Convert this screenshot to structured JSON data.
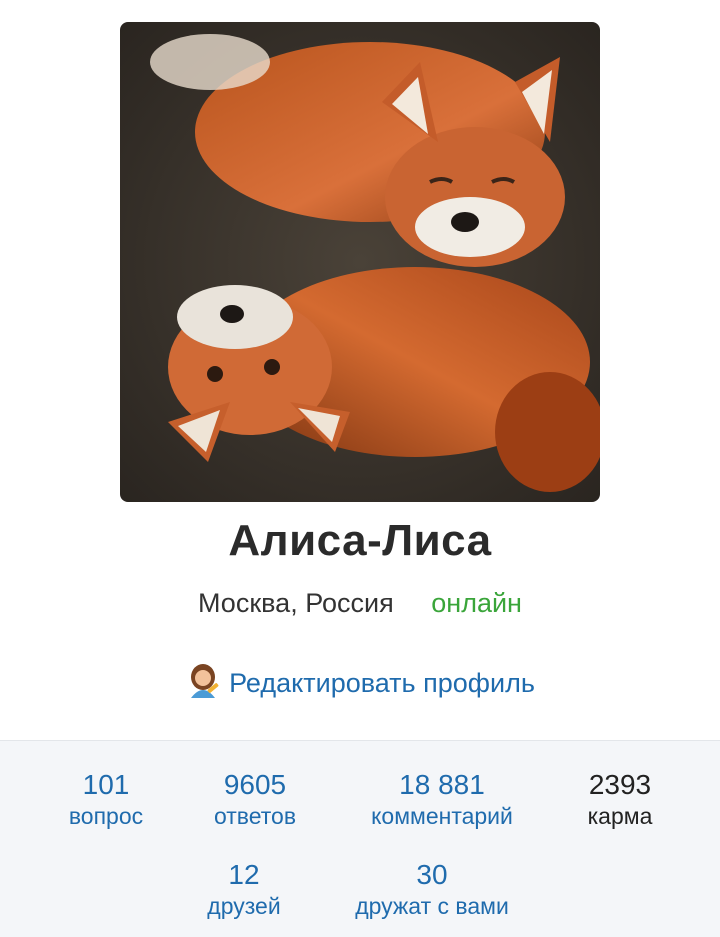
{
  "profile": {
    "avatar_alt": "two-foxes-photo",
    "name": "Алиса-Лиса",
    "location": "Москва, Россия",
    "status": "онлайн",
    "edit_label": "Редактировать профиль"
  },
  "stats": {
    "questions": {
      "value": "101",
      "label": "вопрос"
    },
    "answers": {
      "value": "9605",
      "label": "ответов"
    },
    "comments": {
      "value": "18 881",
      "label": "комментарий"
    },
    "karma": {
      "value": "2393",
      "label": "карма"
    },
    "friends": {
      "value": "12",
      "label": "друзей"
    },
    "followers": {
      "value": "30",
      "label": "дружат с вами"
    }
  },
  "colors": {
    "link": "#1f6bad",
    "online": "#3aa53a",
    "stats_bg": "#f4f6f9"
  }
}
